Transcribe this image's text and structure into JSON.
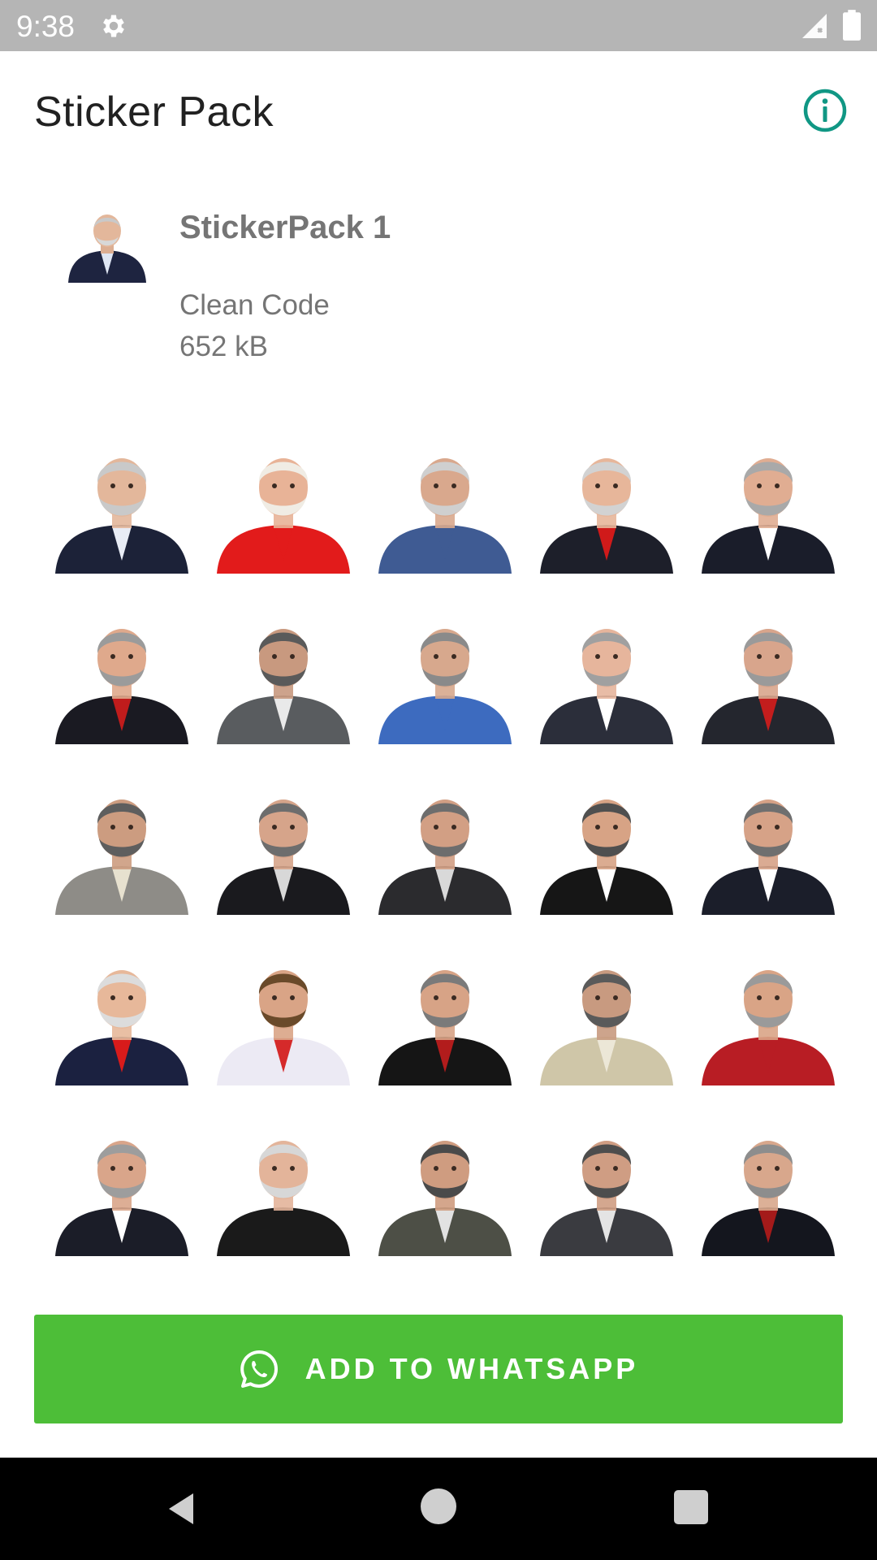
{
  "status_bar": {
    "time": "9:38"
  },
  "app_bar": {
    "title": "Sticker Pack"
  },
  "pack": {
    "name": "StickerPack 1",
    "publisher": "Clean Code",
    "size": "652 kB"
  },
  "stickers": [
    {
      "suit": "#1c2238",
      "shirt": "#e8ecf5",
      "skin": "#e3b79b",
      "hair": "#c9c9c9",
      "bg": "none"
    },
    {
      "suit": "#e21b1b",
      "shirt": "#e21b1b",
      "skin": "#e8b397",
      "hair": "#f0ece4",
      "bg": "none"
    },
    {
      "suit": "#3f5b93",
      "shirt": "#3f5b93",
      "skin": "#d9a88d",
      "hair": "#cfcfcf",
      "bg": "none"
    },
    {
      "suit": "#1d1f2a",
      "shirt": "#d01a1a",
      "skin": "#e7b69a",
      "hair": "#d2d2d2",
      "bg": "none"
    },
    {
      "suit": "#1a1d2a",
      "shirt": "#ffffff",
      "skin": "#e0ad92",
      "hair": "#a9a9a9",
      "bg": "none"
    },
    {
      "suit": "#1a1a22",
      "shirt": "#c01c1c",
      "skin": "#dfa98c",
      "hair": "#9b9b9b",
      "bg": "none"
    },
    {
      "suit": "#595c5f",
      "shirt": "#e9e9e9",
      "skin": "#c8997f",
      "hair": "#5a5a5a",
      "bg": "none"
    },
    {
      "suit": "#3d6bbf",
      "shirt": "#3d6bbf",
      "skin": "#d7a88d",
      "hair": "#8a8a8a",
      "bg": "none"
    },
    {
      "suit": "#2b2e3a",
      "shirt": "#ffffff",
      "skin": "#e6b59c",
      "hair": "#a0a0a0",
      "bg": "none"
    },
    {
      "suit": "#24262e",
      "shirt": "#c31d1d",
      "skin": "#d8a58c",
      "hair": "#9a9a9a",
      "bg": "none"
    },
    {
      "suit": "#8e8c87",
      "shirt": "#e7e1cf",
      "skin": "#cc9c80",
      "hair": "#5e5e5e",
      "bg": "none"
    },
    {
      "suit": "#1a1a1e",
      "shirt": "#d8d8d8",
      "skin": "#d6a48a",
      "hair": "#6d6d6d",
      "bg": "none"
    },
    {
      "suit": "#2b2b2e",
      "shirt": "#d9d9d9",
      "skin": "#d29f84",
      "hair": "#6d6d6d",
      "bg": "none"
    },
    {
      "suit": "#161616",
      "shirt": "#ffffff",
      "skin": "#d7a385",
      "hair": "#4f4f4f",
      "bg": "none"
    },
    {
      "suit": "#1b1e2a",
      "shirt": "#ffffff",
      "skin": "#d6a287",
      "hair": "#6f6f6f",
      "bg": "none"
    },
    {
      "suit": "#1b2140",
      "shirt": "#d81b1b",
      "skin": "#e7b89a",
      "hair": "#dcdcdc",
      "bg": "none"
    },
    {
      "suit": "#eceaf4",
      "shirt": "#d52a2a",
      "skin": "#d9a486",
      "hair": "#6a4a2a",
      "bg": "none"
    },
    {
      "suit": "#151515",
      "shirt": "#b21c1c",
      "skin": "#d7a386",
      "hair": "#7a7a7a",
      "bg": "none"
    },
    {
      "suit": "#cfc6a8",
      "shirt": "#ece7d7",
      "skin": "#c89a80",
      "hair": "#5a5a5a",
      "bg": "none"
    },
    {
      "suit": "#b81d24",
      "shirt": "#b81d24",
      "skin": "#d9a486",
      "hair": "#9a9a9a",
      "bg": "none"
    },
    {
      "suit": "#1b1d28",
      "shirt": "#ffffff",
      "skin": "#d9a58a",
      "hair": "#9d9d9d",
      "bg": "none"
    },
    {
      "suit": "#1a1a1a",
      "shirt": "#1a1a1a",
      "skin": "#e3b49a",
      "hair": "#d7d7d7",
      "bg": "none"
    },
    {
      "suit": "#4d4f46",
      "shirt": "#e2e2e2",
      "skin": "#cf9c80",
      "hair": "#4a4a4a",
      "bg": "none"
    },
    {
      "suit": "#3a3b40",
      "shirt": "#e4e4e4",
      "skin": "#cf9d83",
      "hair": "#4d4d4d",
      "bg": "none"
    },
    {
      "suit": "#14161e",
      "shirt": "#a41a1a",
      "skin": "#d8a78c",
      "hair": "#8d8d8d",
      "bg": "none"
    }
  ],
  "add_button": {
    "label": "ADD TO WHATSAPP"
  },
  "colors": {
    "accent": "#4dbe38",
    "info": "#109784"
  },
  "icons": {
    "settings": "gear-icon",
    "signal": "signal-icon",
    "battery": "battery-icon",
    "info": "info-icon",
    "whatsapp": "whatsapp-icon",
    "back": "back-icon",
    "home": "home-icon",
    "recents": "recents-icon"
  }
}
